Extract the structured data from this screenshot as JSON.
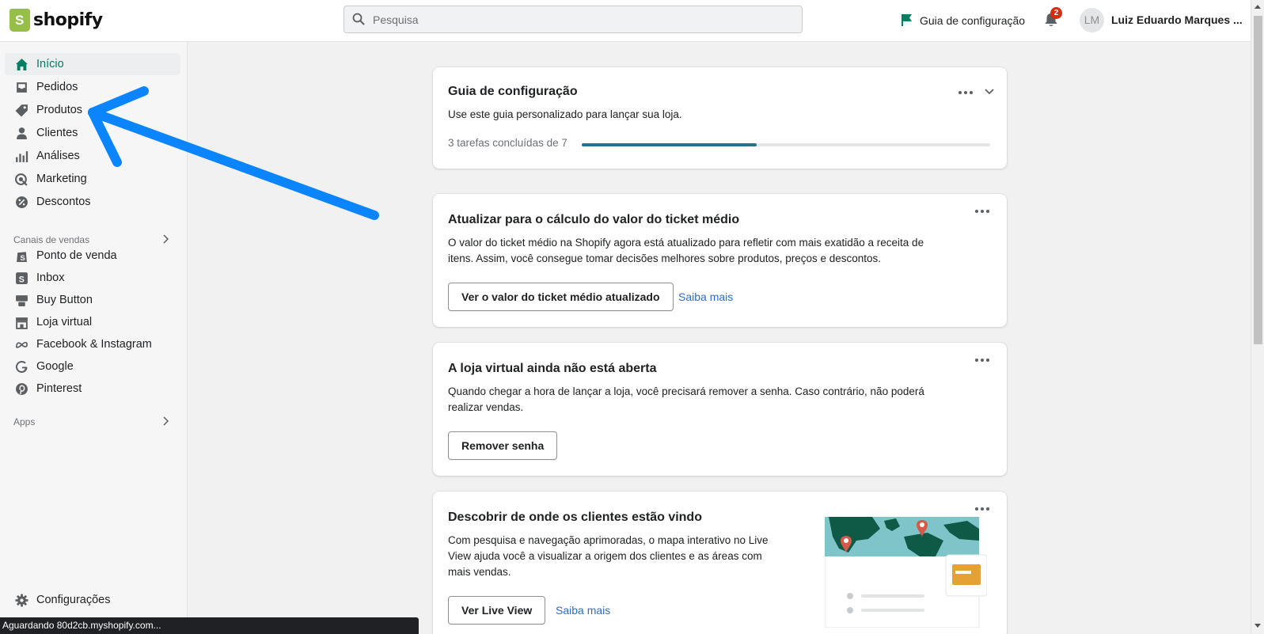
{
  "topbar": {
    "logo_text": "shopify",
    "search_placeholder": "Pesquisa",
    "setup_guide_label": "Guia de configuração",
    "notification_count": "2",
    "avatar_initials": "LM",
    "user_name": "Luiz Eduardo Marques ..."
  },
  "sidebar": {
    "items": [
      {
        "label": "Início",
        "icon": "home-icon",
        "active": true
      },
      {
        "label": "Pedidos",
        "icon": "inbox-tray-icon"
      },
      {
        "label": "Produtos",
        "icon": "tag-icon"
      },
      {
        "label": "Clientes",
        "icon": "person-icon"
      },
      {
        "label": "Análises",
        "icon": "bar-chart-icon"
      },
      {
        "label": "Marketing",
        "icon": "target-icon"
      },
      {
        "label": "Descontos",
        "icon": "discount-icon"
      }
    ],
    "sales_channels_label": "Canais de vendas",
    "channels": [
      {
        "label": "Ponto de venda",
        "icon": "shopify-bag-icon"
      },
      {
        "label": "Inbox",
        "icon": "shopify-inbox-icon"
      },
      {
        "label": "Buy Button",
        "icon": "buy-button-icon"
      },
      {
        "label": "Loja virtual",
        "icon": "store-icon"
      },
      {
        "label": "Facebook & Instagram",
        "icon": "meta-icon"
      },
      {
        "label": "Google",
        "icon": "google-icon"
      },
      {
        "label": "Pinterest",
        "icon": "pinterest-icon"
      }
    ],
    "apps_label": "Apps",
    "settings_label": "Configurações"
  },
  "cards": {
    "setup": {
      "title": "Guia de configuração",
      "description": "Use este guia personalizado para lançar sua loja.",
      "progress_text": "3 tarefas concluídas de 7",
      "progress_fraction": 0.4286
    },
    "ticket": {
      "title": "Atualizar para o cálculo do valor do ticket médio",
      "line1": "O valor do ticket médio na Shopify agora está atualizado para refletir com mais exatidão a receita de",
      "line2": "itens. Assim, você consegue tomar decisões melhores sobre produtos, preços e descontos.",
      "button": "Ver o valor do ticket médio atualizado",
      "link": "Saiba mais"
    },
    "store": {
      "title": "A loja virtual ainda não está aberta",
      "line1": "Quando chegar a hora de lançar a loja, você precisará remover a senha. Caso contrário, não poderá",
      "line2": "realizar vendas.",
      "button": "Remover senha"
    },
    "live": {
      "title": "Descobrir de onde os clientes estão vindo",
      "line1": "Com pesquisa e navegação aprimoradas, o mapa interativo no Live",
      "line2": "View ajuda você a visualizar a origem dos clientes e as áreas com",
      "line3": "mais vendas.",
      "button": "Ver Live View",
      "link": "Saiba mais"
    }
  },
  "status_bar": "Aguardando 80d2cb.myshopify.com...",
  "colors": {
    "accent_green": "#008060",
    "link_blue": "#2c6ecb",
    "annotation_arrow": "#0a84ff",
    "progress": "#2c6e8e",
    "badge_red": "#d72c0d"
  }
}
